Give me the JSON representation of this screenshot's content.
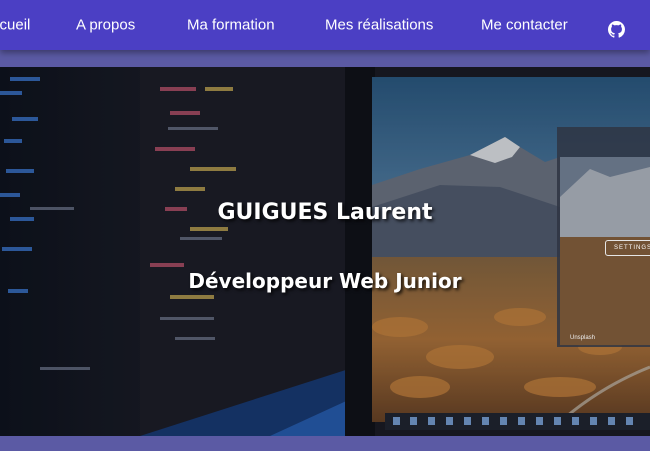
{
  "nav": {
    "items": [
      {
        "label": "Accueil"
      },
      {
        "label": "A propos"
      },
      {
        "label": "Ma formation"
      },
      {
        "label": "Mes réalisations"
      },
      {
        "label": "Me contacter"
      }
    ],
    "github_icon": "github-icon",
    "background": "#4b3fc4"
  },
  "hero": {
    "name": "GUIGUES Laurent",
    "title": "Développeur Web Junior",
    "screen_button": "SETTINGS",
    "screen_credit": "Unsplash"
  },
  "colors": {
    "page_band": "#5b5aa4",
    "text": "#ffffff"
  }
}
